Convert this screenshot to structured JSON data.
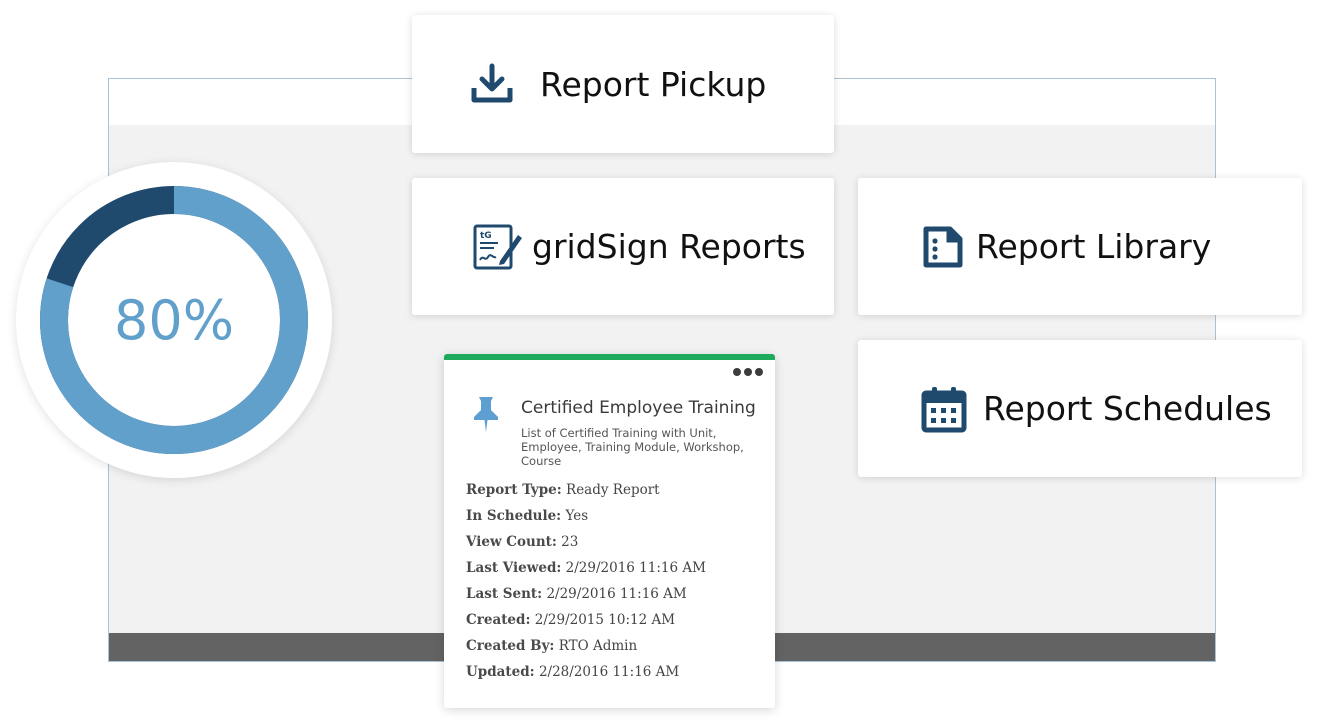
{
  "colors": {
    "primary_dark": "#1f4a6e",
    "primary_light": "#62a0cc",
    "card_accent": "#1eaa5d",
    "footer_bar": "#636363",
    "window_body": "#f2f2f2"
  },
  "gauge": {
    "value_percent": 80,
    "label": "80%"
  },
  "tiles": {
    "report_pickup": {
      "label": "Report Pickup",
      "icon": "download-icon"
    },
    "gridsign_reports": {
      "label": "gridSign Reports",
      "icon": "gridsign-signature-icon"
    },
    "report_library": {
      "label": "Report Library",
      "icon": "document-list-icon"
    },
    "report_schedules": {
      "label": "Report Schedules",
      "icon": "calendar-icon"
    }
  },
  "report_card": {
    "icon": "pin-icon",
    "menu_icon": "more-horizontal-icon",
    "title": "Certified Employee Training",
    "description": "List of Certified Training with Unit, Employee, Training Module, Workshop, Course",
    "fields": [
      {
        "label": "Report Type:",
        "value": "Ready Report"
      },
      {
        "label": "In Schedule:",
        "value": "Yes"
      },
      {
        "label": "View Count:",
        "value": "23"
      },
      {
        "label": "Last Viewed:",
        "value": "2/29/2016 11:16 AM"
      },
      {
        "label": "Last Sent:",
        "value": "2/29/2016 11:16 AM"
      },
      {
        "label": "Created:",
        "value": "2/29/2015 10:12 AM"
      },
      {
        "label": "Created By:",
        "value": "RTO Admin"
      },
      {
        "label": "Updated:",
        "value": "2/28/2016 11:16 AM"
      }
    ]
  }
}
